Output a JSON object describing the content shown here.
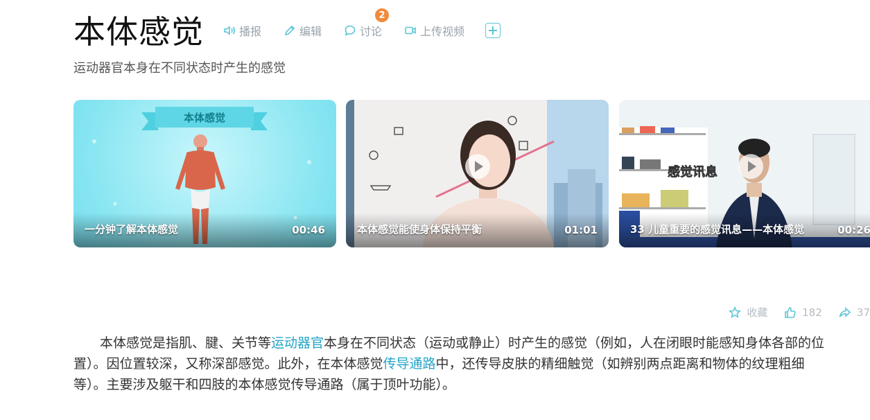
{
  "title": "本体感觉",
  "toolbar": {
    "play_label": "播报",
    "edit_label": "编辑",
    "discuss_label": "讨论",
    "discuss_count": "2",
    "upload_label": "上传视频"
  },
  "subtitle": "运动器官本身在不同状态时产生的感觉",
  "videos": [
    {
      "title": "一分钟了解本体感觉",
      "duration": "00:46",
      "banner": "本体感觉"
    },
    {
      "title": "本体感觉能使身体保持平衡",
      "duration": "01:01"
    },
    {
      "title": "33 儿童重要的感觉讯息——本体感觉",
      "duration": "00:26",
      "overlay_text": "感觉讯息"
    }
  ],
  "stats": {
    "collect_label": "收藏",
    "like_count": "182",
    "share_count": "37"
  },
  "paragraph": {
    "p1": "本体感觉是指肌、腱、关节等",
    "link1": "运动器官",
    "p2": "本身在不同状态（运动或静止）时产生的感觉（例如，人在闭眼时能感知身体各部的位置）。因位置较深，又称深部感觉。此外，在本体感觉",
    "link2": "传导通路",
    "p3": "中，还传导皮肤的精细触觉（如辨别两点距离和物体的纹理粗细等）。主要涉及躯干和四肢的本体感觉传导通路（属于顶叶功能）。"
  },
  "colors": {
    "accent": "#5bc5d6",
    "link": "#22a4c8",
    "badge": "#f28a3c"
  }
}
